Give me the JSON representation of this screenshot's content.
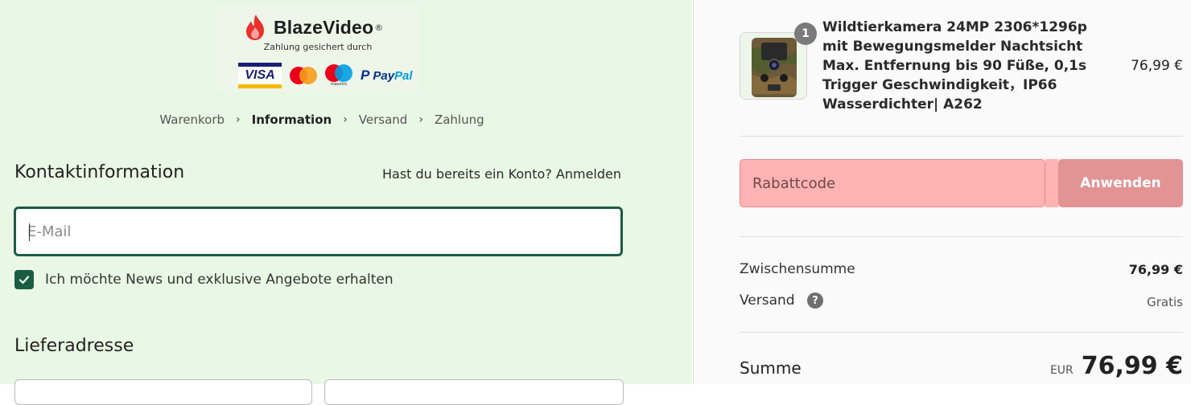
{
  "brand": {
    "name": "BlazeVideo",
    "secured_text": "Zahlung gesichert durch",
    "payment_methods": [
      "VISA",
      "maestro",
      "PayPal"
    ],
    "colors": {
      "flame": "#e8332c",
      "accent": "#1a5d44"
    }
  },
  "breadcrumb": {
    "steps": [
      "Warenkorb",
      "Information",
      "Versand",
      "Zahlung"
    ],
    "active": "Information"
  },
  "contact": {
    "heading": "Kontaktinformation",
    "login_prompt": "Hast du bereits ein Konto? Anmelden",
    "email_placeholder": "E-Mail",
    "newsletter_label": "Ich möchte News und exklusive Angebote erhalten",
    "newsletter_checked": true
  },
  "delivery": {
    "heading": "Lieferadresse"
  },
  "order": {
    "product": {
      "quantity": "1",
      "title": "Wildtierkamera 24MP 2306*1296p mit Bewegungsmelder Nachtsicht Max. Entfernung bis 90 Füße, 0,1s Trigger Geschwindigkeit，IP66 Wasserdichter| A262",
      "price": "76,99 €"
    },
    "coupon": {
      "placeholder": "Rabattcode",
      "button": "Anwenden"
    },
    "subtotal": {
      "label": "Zwischensumme",
      "value": "76,99 €"
    },
    "shipping": {
      "label": "Versand",
      "value": "Gratis",
      "help_icon": "question-circle-icon"
    },
    "total": {
      "label": "Summe",
      "currency": "EUR",
      "value": "76,99 €"
    }
  }
}
